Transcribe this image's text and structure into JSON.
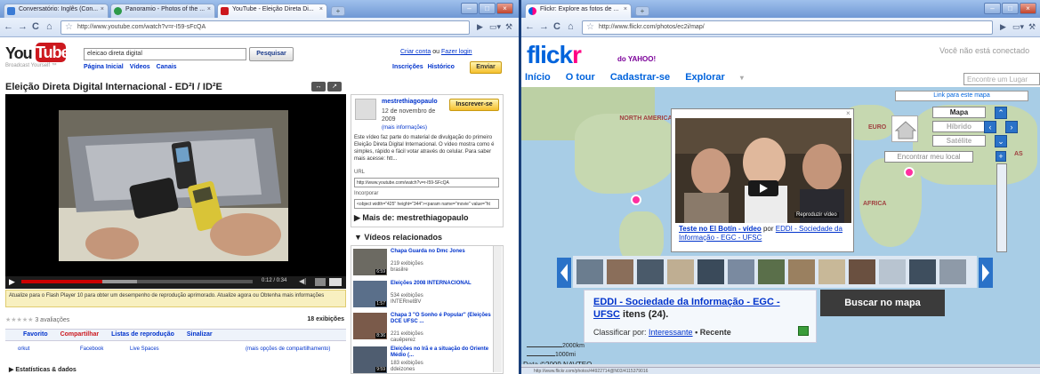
{
  "left_window": {
    "tabs": [
      {
        "label": "Conversatório: Inglês (Con..."
      },
      {
        "label": "Panoramio - Photos of the ..."
      },
      {
        "label": "YouTube - Eleição Direta Di..."
      }
    ],
    "url": "http://www.youtube.com/watch?v=r-I59-sFcQA",
    "youtube": {
      "logo_you": "You",
      "logo_tube": "Tube",
      "broadcast": "Broadcast Yourself ™",
      "search_value": "eleicao direta digital",
      "search_button": "Pesquisar",
      "nav": [
        "Página Inicial",
        "Vídeos",
        "Canais"
      ],
      "create_account": "Criar conta",
      "or": "ou",
      "login": "Fazer login",
      "subscriptions": "Inscrições",
      "history": "Histórico",
      "upload": "Enviar",
      "video_title": "Eleição Direta Digital Internacional - ED²I / ID²E",
      "player": {
        "time": "0:12 / 0:34",
        "progress": 0.35
      },
      "flash_msg": "Atualize para o Flash Player 10 para obter um desempenho de reprodução aprimorado. Atualize agora ou Obtenha mais informações",
      "ratings": "3 avaliações",
      "views": "18 exibições",
      "actions": [
        "Favorito",
        "Compartilhar",
        "Listas de reprodução",
        "Sinalizar"
      ],
      "share": [
        "orkut",
        "Facebook",
        "Live Spaces",
        "(mais opções de compartilhamento)"
      ],
      "stats": "Estatísticas & dados",
      "channel": "mestrethiagopaulo",
      "date": "12 de novembro de 2009",
      "more_info": "(mais informações)",
      "subscribe": "Inscrever-se",
      "description": "Este vídeo faz parte do material de divulgação do primeiro Eleição Direta Digital Internacional. O vídeo mostra como é simples, rápido e fácil votar através do celular. Para saber mais acesse: htt...",
      "url_label": "URL",
      "url_value": "http://www.youtube.com/watch?v=r-I59-SFcQA",
      "embed_label": "Incorporar",
      "embed_value": "<object width=\"425\" height=\"344\"><param name=\"movie\" value=\"ht",
      "more_from": "Mais de: mestrethiagopaulo",
      "related_head": "Vídeos relacionados",
      "related": [
        {
          "title": "Chapa Guarda no Dmc Jones",
          "meta": "219 exibições",
          "user": "brasilre",
          "dur": "6:59"
        },
        {
          "title": "Eleições 2008 INTERNACIONAL",
          "meta": "534 exibições",
          "user": "INTERnetBV",
          "dur": "1:57"
        },
        {
          "title": "Chapa 3 \"O Sonho é Popular\" (Eleições DCE UFSC ...",
          "meta": "221 exibições",
          "user": "cauêperez",
          "dur": "8:36"
        },
        {
          "title": "Eleições no Irã e a situação do Oriente Médio (...",
          "meta": "183 exibições",
          "user": "ddeizones",
          "dur": "9:59"
        }
      ]
    }
  },
  "right_window": {
    "tabs": [
      {
        "label": "Flickr: Explore as fotos de ..."
      }
    ],
    "url": "http://www.flickr.com/photos/ec2i/map/",
    "flickr": {
      "logo_a": "flick",
      "logo_b": "r",
      "yahoo": "do YAHOO!",
      "not_signed": "Você não está conectado",
      "nav": [
        "Início",
        "O tour",
        "Cadastrar-se",
        "Explorar"
      ],
      "find_placeholder": "Encontre um Lugar",
      "map_link": "Link para este mapa",
      "map_types": [
        "Mapa",
        "Híbrido",
        "Satélite"
      ],
      "find_me": "Encontrar meu local",
      "labels": [
        "NORTH AMERICA",
        "EURO",
        "AFRICA",
        "AS"
      ],
      "popup_caption_link": "Teste no El Botín - vídeo",
      "popup_by": "por",
      "popup_owner": "EDDI - Sociedade da Informação - EGC - UFSC",
      "play_label": "Reproduzir vídeo",
      "set_title": "EDDI - Sociedade da Informação - EGC - UFSC",
      "set_count": "itens (24).",
      "sort_label": "Classificar por:",
      "sort_interesting": "Interessante",
      "sort_recent": "• Recente",
      "search_map": "Buscar no mapa",
      "scale_km": "2000km",
      "scale_mi": "1000mi",
      "data_credit": "Data ©2009 NAVTEQ",
      "status_url": "http://www.flickr.com/photos/44922714@N03/4115379016"
    }
  },
  "colors": {
    "youtube_red": "#cc181e",
    "flickr_blue": "#0063dc",
    "flickr_pink": "#ff0084",
    "map_water": "#a8cde6"
  }
}
